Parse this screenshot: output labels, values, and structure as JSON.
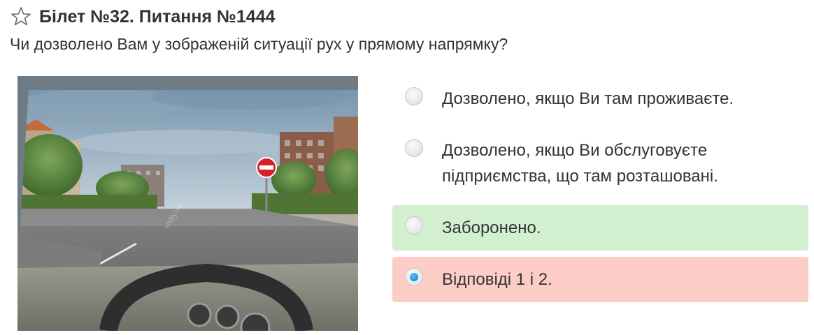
{
  "header": {
    "title": "Білет №32. Питання №1444",
    "question": "Чи дозволено Вам у зображеній ситуації рух у прямому напрямку?"
  },
  "illustration": {
    "watermark": "vodiy.ua",
    "sign": "no-entry"
  },
  "answers": [
    {
      "text": "Дозволено, якщо Ви там проживаєте.",
      "state": "neutral",
      "selected": false
    },
    {
      "text": "Дозволено, якщо Ви обслуговуєте підприємства, що там розташовані.",
      "state": "neutral",
      "selected": false
    },
    {
      "text": "Заборонено.",
      "state": "correct",
      "selected": false
    },
    {
      "text": "Відповіді 1 і 2.",
      "state": "wrong",
      "selected": true
    }
  ],
  "colors": {
    "correct_bg": "#d2f0cf",
    "wrong_bg": "#fcccc7",
    "radio_selected": "#1f8fe0",
    "text": "#333333"
  }
}
